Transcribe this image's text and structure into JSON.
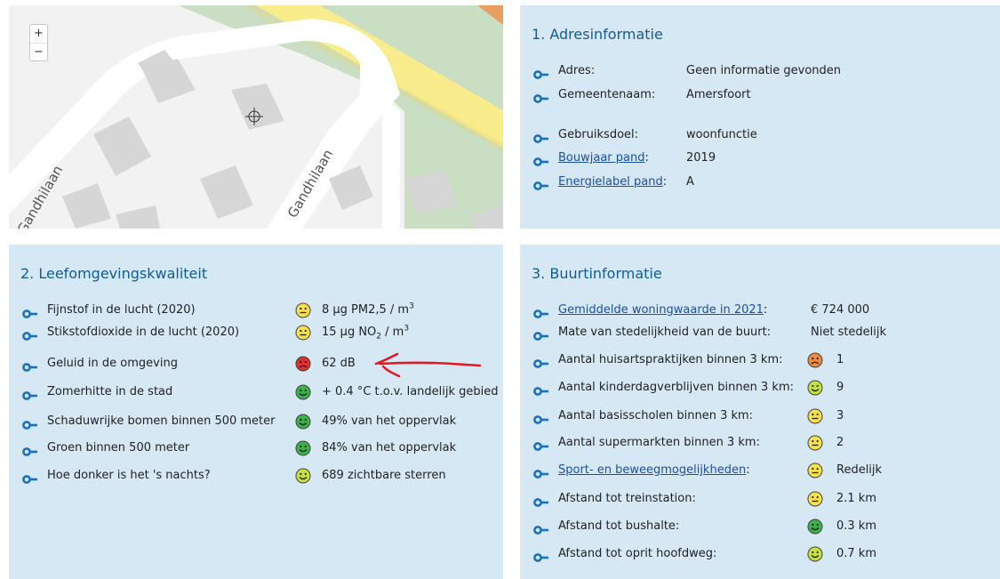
{
  "map": {
    "zoom_in": "+",
    "zoom_out": "−",
    "street_label_1": "Gandhilaan",
    "street_label_2": "Gandhilaan"
  },
  "adres": {
    "title": "1. Adresinformatie",
    "rows": [
      {
        "label": "Adres:",
        "value": "Geen informatie gevonden",
        "link": false
      },
      {
        "label": "Gemeentenaam:",
        "value": "Amersfoort",
        "link": false
      },
      {
        "label": "Gebruiksdoel:",
        "value": "woonfunctie",
        "link": false
      },
      {
        "label": "Bouwjaar pand",
        "suffix": ":",
        "value": "2019",
        "link": true
      },
      {
        "label": "Energielabel pand",
        "suffix": ":",
        "value": "A",
        "link": true
      }
    ]
  },
  "leef": {
    "title": "2. Leefomgevingskwaliteit",
    "rows": [
      {
        "label": "Fijnstof in de lucht (2020)",
        "suffix": ":",
        "value": "8 µg PM2,5 / m",
        "sup": "3",
        "smiley": "yellow-neutral"
      },
      {
        "label": "Stikstofdioxide in de lucht (2020)",
        "suffix": ":",
        "value": "15 µg NO",
        "sub": "2",
        "value_rest": " / m",
        "sup": "3",
        "smiley": "yellow-neutral"
      },
      {
        "label": "Geluid in de omgeving",
        "suffix": ":",
        "value": "62 dB",
        "smiley": "red-sad"
      },
      {
        "label": "Zomerhitte in de stad",
        "suffix": ":",
        "value": "+ 0.4 °C t.o.v. landelijk gebied",
        "smiley": "green-happy"
      },
      {
        "label": "Schaduwrijke bomen binnen 500 meter",
        "suffix": ":",
        "value": "49% van het oppervlak",
        "smiley": "green-happy"
      },
      {
        "label": "Groen binnen 500 meter",
        "suffix": ":",
        "value": "84% van het oppervlak",
        "smiley": "green-happy"
      },
      {
        "label": "Hoe donker is het 's nachts?",
        "suffix": ":",
        "value": "689 zichtbare sterren",
        "smiley": "lime-happy"
      }
    ]
  },
  "buurt": {
    "title": "3. Buurtinformatie",
    "rows": [
      {
        "label": "Gemiddelde woningwaarde in 2021",
        "suffix": ":",
        "value": "€ 724 000",
        "link": true,
        "smiley": null
      },
      {
        "label": "Mate van stedelijkheid van de buurt:",
        "value": "Niet stedelijk",
        "link": false,
        "smiley": null
      },
      {
        "label": "Aantal huisartspraktijken binnen 3 km:",
        "value": "1",
        "link": false,
        "smiley": "orange-sad"
      },
      {
        "label": "Aantal kinderdagverblijven binnen 3 km:",
        "value": "9",
        "link": false,
        "smiley": "lime-happy"
      },
      {
        "label": "Aantal basisscholen binnen 3 km:",
        "value": "3",
        "link": false,
        "smiley": "yellow-neutral"
      },
      {
        "label": "Aantal supermarkten binnen 3 km:",
        "value": "2",
        "link": false,
        "smiley": "yellow-neutral"
      },
      {
        "label": "Sport- en beweegmogelijkheden",
        "suffix": ":",
        "value": "Redelijk",
        "link": true,
        "smiley": "yellow-neutral"
      },
      {
        "label": "Afstand tot treinstation:",
        "value": "2.1 km",
        "link": false,
        "smiley": "yellow-neutral"
      },
      {
        "label": "Afstand tot bushalte:",
        "value": "0.3 km",
        "link": false,
        "smiley": "green-happy"
      },
      {
        "label": "Afstand tot oprit hoofdweg:",
        "value": "0.7 km",
        "link": false,
        "smiley": "lime-happy"
      }
    ]
  },
  "colors": {
    "panel_bg": "#d7e8f5",
    "accent": "#0f5c9a",
    "link": "#1a4fa8",
    "annotation": "#e8141e"
  }
}
